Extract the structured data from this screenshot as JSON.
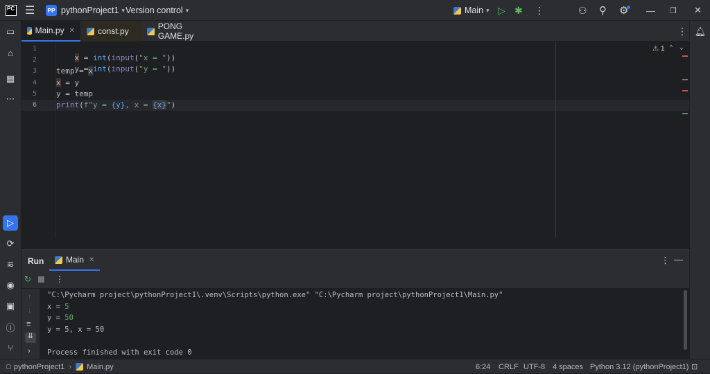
{
  "titlebar": {
    "app_logo": "PC",
    "project_badge": "PP",
    "project_name": "pythonProject1",
    "vcs": "Version control",
    "run_config": "Main",
    "icons": [
      "hamburger-menu-icon",
      "run-icon",
      "debug-icon",
      "more-icon",
      "add-user-icon",
      "search-icon",
      "settings-icon",
      "minimize-icon",
      "restore-icon",
      "close-icon"
    ]
  },
  "tabs": [
    {
      "label": "Main.py",
      "active": true
    },
    {
      "label": "const.py",
      "active": false
    },
    {
      "label": "PONG GAME.py",
      "active": false
    }
  ],
  "editor": {
    "line_numbers": [
      "1",
      "2",
      "3",
      "4",
      "5",
      "6"
    ],
    "lines": [
      "x = int(input(\"x = \"))",
      "y = int(input(\"y = \"))",
      "temp = x",
      "x = y",
      "y = temp",
      "print(f\"y = {y}, x = {x}\")"
    ],
    "inspection_count": "1",
    "current_line": 6
  },
  "run_panel": {
    "tab_run": "Run",
    "tab_main": "Main",
    "output": [
      {
        "text": "\"C:\\Pycharm project\\pythonProject1\\.venv\\Scripts\\python.exe\" \"C:\\Pycharm project\\pythonProject1\\Main.py\"",
        "input": false
      },
      {
        "text": "x = ",
        "input": false,
        "value": "5"
      },
      {
        "text": "y = ",
        "input": false,
        "value": "50"
      },
      {
        "text": "y = 5, x = 50",
        "input": false
      },
      {
        "text": "",
        "input": false
      },
      {
        "text": "Process finished with exit code 0",
        "input": false
      }
    ]
  },
  "statusbar": {
    "breadcrumb_project": "pythonProject1",
    "breadcrumb_file": "Main.py",
    "position": "6:24",
    "line_ending": "CRLF",
    "encoding": "UTF-8",
    "indent": "4 spaces",
    "interpreter": "Python 3.12 (pythonProject1)"
  },
  "colors": {
    "accent": "#3574f0",
    "background": "#1e1f22",
    "panel": "#2b2d30",
    "string": "#6aab73",
    "keyword": "#56a8f5"
  }
}
